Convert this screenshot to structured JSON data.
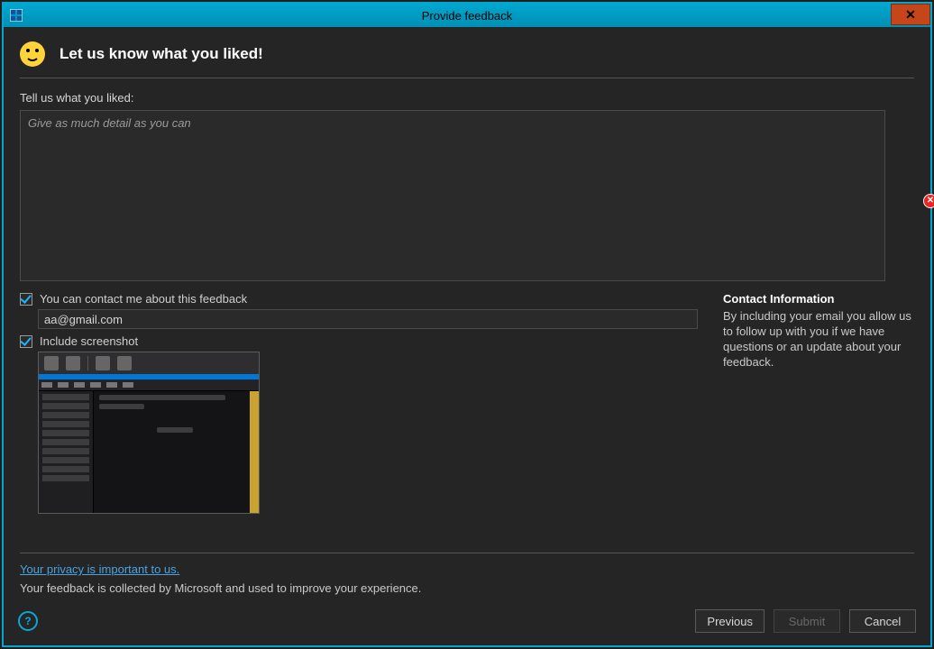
{
  "window": {
    "title": "Provide feedback"
  },
  "header": {
    "heading": "Let us know what you liked!"
  },
  "form": {
    "prompt_label": "Tell us what you liked:",
    "placeholder": "Give as much detail as you can",
    "feedback_value": "",
    "contact_checkbox_label": "You can contact me about this feedback",
    "contact_checked": true,
    "email_value": "aa@gmail.com",
    "screenshot_checkbox_label": "Include screenshot",
    "screenshot_checked": true
  },
  "contact_panel": {
    "title": "Contact Information",
    "body": "By including your email you allow us to follow up with you if we have questions or an update about your feedback."
  },
  "privacy": {
    "link": "Your privacy is important to us.",
    "sub": "Your feedback is collected by Microsoft and used to improve your experience."
  },
  "buttons": {
    "previous": "Previous",
    "submit": "Submit",
    "cancel": "Cancel"
  },
  "validation": {
    "has_error": true
  }
}
